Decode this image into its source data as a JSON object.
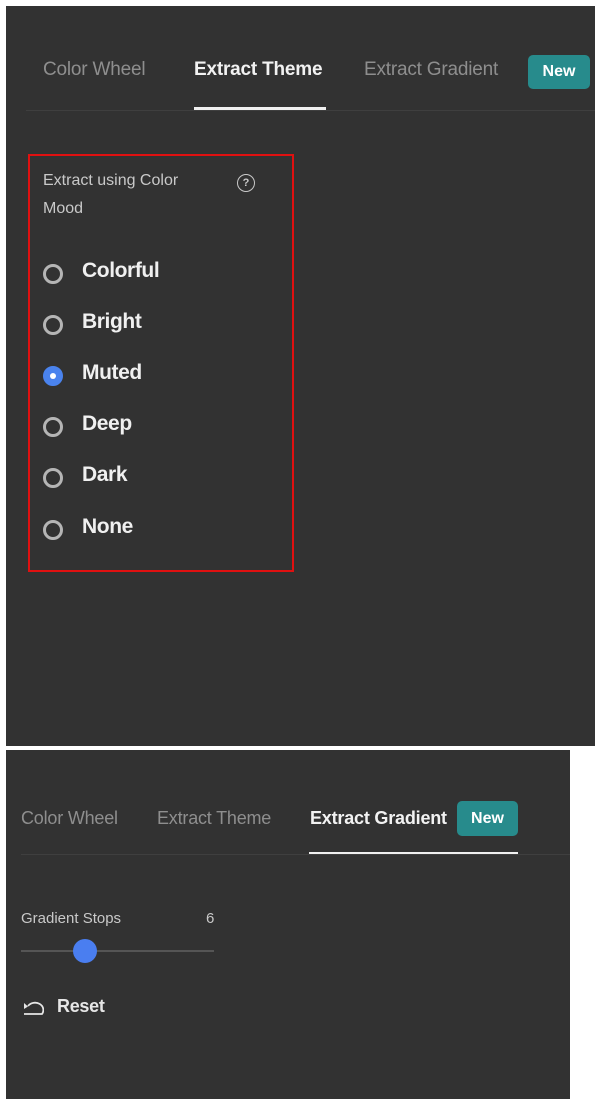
{
  "top_panel": {
    "tabs": [
      {
        "label": "Color Wheel",
        "active": false
      },
      {
        "label": "Extract Theme",
        "active": true
      },
      {
        "label": "Extract Gradient",
        "active": false
      }
    ],
    "badge": "New",
    "mood": {
      "title": "Extract using Color Mood",
      "help_icon": "?",
      "options": [
        "Colorful",
        "Bright",
        "Muted",
        "Deep",
        "Dark",
        "None"
      ],
      "selected": "Muted"
    }
  },
  "bottom_panel": {
    "tabs": [
      {
        "label": "Color Wheel",
        "active": false
      },
      {
        "label": "Extract Theme",
        "active": false
      },
      {
        "label": "Extract Gradient",
        "active": true
      }
    ],
    "badge": "New",
    "gradient_stops": {
      "label": "Gradient Stops",
      "value": "6",
      "slider_fraction": 0.33
    },
    "reset_label": "Reset"
  },
  "colors": {
    "panel_bg": "#323232",
    "accent_blue": "#4a83ee",
    "badge_teal": "#278b8c",
    "highlight_red": "#e01010"
  }
}
